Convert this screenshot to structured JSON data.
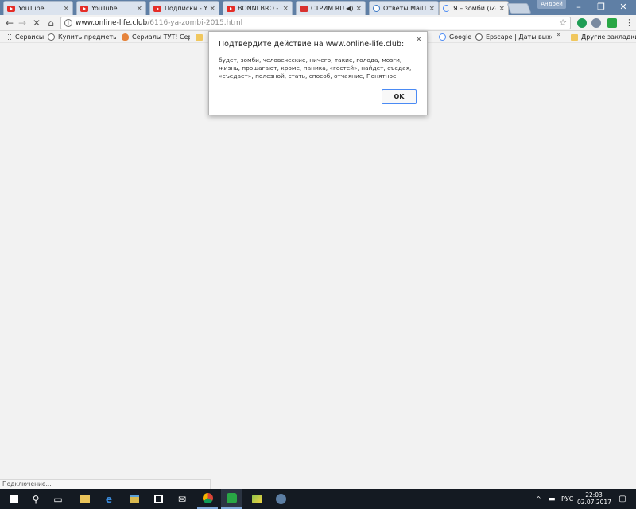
{
  "browser": {
    "tabs": [
      {
        "label": "YouTube",
        "icon": "youtube-icon"
      },
      {
        "label": "YouTube",
        "icon": "youtube-icon"
      },
      {
        "label": "Подписки - You",
        "icon": "youtube-icon"
      },
      {
        "label": "BONNI BRO - Y",
        "icon": "youtube-icon"
      },
      {
        "label": "СТРИМ RUS",
        "icon": "live-icon"
      },
      {
        "label": "Ответы Mail.Ru",
        "icon": "mail-answers-icon"
      },
      {
        "label": "Я – зомби (iZom",
        "icon": "loading-icon"
      }
    ],
    "user_name": "Андрей",
    "window_controls": {
      "minimize": "–",
      "restore": "❐",
      "close": "✕"
    },
    "nav": {
      "back": "←",
      "forward": "→",
      "stop": "✕",
      "home": "⌂"
    },
    "address": {
      "host": "www.online-life.club",
      "path": "/6116-ya-zombi-2015.html"
    },
    "bookmarks": [
      {
        "label": "Сервисы",
        "icon": "apps-grid-icon"
      },
      {
        "label": "Купить предметы | M",
        "icon": "globe-icon"
      },
      {
        "label": "Сериалы ТУТ! Сериа",
        "icon": "flame-icon"
      },
      {
        "label": "",
        "icon": "folder-icon"
      }
    ],
    "bookmarks_right": [
      {
        "label": "Google",
        "icon": "google-icon"
      },
      {
        "label": "Epscape | Даты выхо",
        "icon": "epscape-icon"
      }
    ],
    "bookmarks_overflow": "»",
    "other_bookmarks": "Другие закладки"
  },
  "dialog": {
    "title": "Подтвердите действие на www.online-life.club:",
    "message": "будет, зомби, человеческие, ничего, такие, голода, мозги, жизнь, прошагают, кроме, паника, «гостей», найдет, съедая, «съедает», полезной, стать, способ, отчаяние, Понятное",
    "ok": "OK",
    "close": "×"
  },
  "status_text": "Подключение...",
  "taskbar": {
    "items": [
      {
        "name": "start-button",
        "glyph": ""
      },
      {
        "name": "search-icon",
        "glyph": "⚲"
      },
      {
        "name": "task-view-icon",
        "glyph": "▭"
      },
      {
        "name": "explorer-icon",
        "glyph": ""
      },
      {
        "name": "edge-icon",
        "glyph": "e"
      },
      {
        "name": "file-manager-icon",
        "glyph": ""
      },
      {
        "name": "store-icon",
        "glyph": ""
      },
      {
        "name": "mail-icon",
        "glyph": "✉"
      },
      {
        "name": "chrome-icon",
        "glyph": ""
      },
      {
        "name": "kaspersky-icon",
        "glyph": ""
      },
      {
        "name": "bluestacks-icon",
        "glyph": ""
      },
      {
        "name": "steam-icon",
        "glyph": ""
      }
    ],
    "tray_lang": "РУС",
    "tray_chevron": "^",
    "time": "22:03",
    "date": "02.07.2017"
  }
}
